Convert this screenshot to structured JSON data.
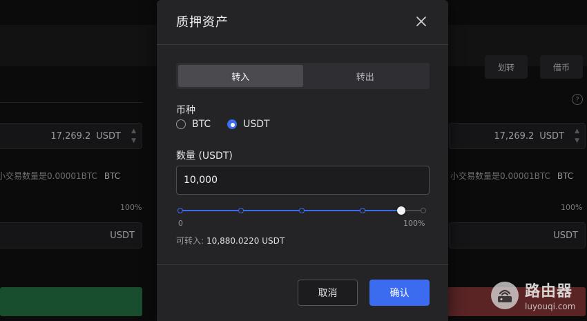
{
  "background": {
    "tabs": [
      "划转",
      "借币"
    ],
    "help": "?",
    "fields": [
      {
        "value": "17,269.2",
        "unit": "USDT"
      },
      {
        "value": "17,269.2",
        "unit": "USDT"
      }
    ],
    "hints": [
      {
        "text": "小交易数量是0.00001BTC",
        "unit": "BTC"
      },
      {
        "text": "小交易数量是0.00001BTC",
        "unit": "BTC"
      }
    ],
    "percent_labels": [
      "100%",
      "100%"
    ],
    "usdt_labels": [
      "USDT",
      "USDT"
    ],
    "buy_color": "#227a44",
    "sell_color": "#9c3b3b"
  },
  "modal": {
    "title": "质押资产",
    "tabs": [
      {
        "label": "转入",
        "active": true
      },
      {
        "label": "转出",
        "active": false
      }
    ],
    "coin_label": "币种",
    "coins": [
      {
        "label": "BTC",
        "checked": false
      },
      {
        "label": "USDT",
        "checked": true
      }
    ],
    "amount_label": "数量 (USDT)",
    "amount_value": "10,000",
    "slider": {
      "min_label": "0",
      "max_label": "100%",
      "stops": [
        0,
        25,
        50,
        75,
        100
      ],
      "value_percent": 91
    },
    "available_label": "可转入:",
    "available_value": "10,880.0220 USDT",
    "cancel_label": "取消",
    "confirm_label": "确认",
    "accent_color": "#3b6cf0"
  },
  "watermark": {
    "name": "路由器",
    "domain": "luyouqi.com"
  }
}
